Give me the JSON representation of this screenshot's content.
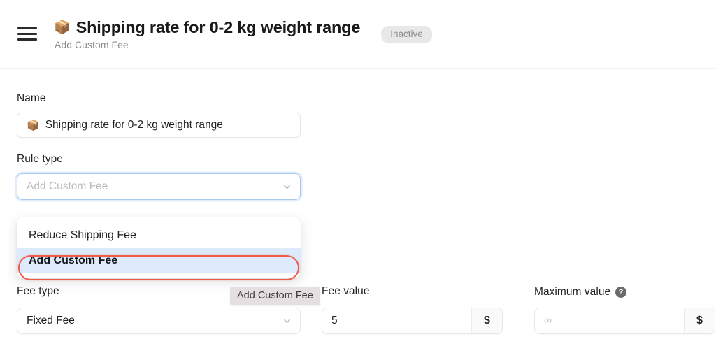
{
  "header": {
    "menu_icon": "hamburger-icon",
    "title_emoji": "📦",
    "title": "Shipping rate for 0-2 kg weight range",
    "subtitle": "Add Custom Fee",
    "status_badge": "Inactive"
  },
  "form": {
    "name": {
      "label": "Name",
      "emoji": "📦",
      "value": "Shipping rate for 0-2 kg weight range"
    },
    "rule_type": {
      "label": "Rule type",
      "placeholder": "Add Custom Fee",
      "value": "",
      "chevron_icon": "chevron-down-icon",
      "options": [
        {
          "label": "Reduce Shipping Fee",
          "selected": false
        },
        {
          "label": "Add Custom Fee",
          "selected": true
        }
      ]
    },
    "fee_type": {
      "label": "Fee type",
      "value": "Fixed Fee",
      "chevron_icon": "chevron-down-icon"
    },
    "fee_value": {
      "label": "Fee value",
      "value": "5",
      "suffix": "$"
    },
    "maximum_value": {
      "label": "Maximum value",
      "help_icon": "question-mark-icon",
      "placeholder": "∞",
      "value": "",
      "suffix": "$"
    }
  },
  "tooltip": {
    "text": "Add Custom Fee"
  },
  "colors": {
    "accent_highlight": "#ee5b4b",
    "option_selected_bg": "#ddeafb",
    "focus_ring": "#a9cbf0",
    "badge_bg": "#e8e8e8",
    "tooltip_bg": "#e6dfe1"
  }
}
